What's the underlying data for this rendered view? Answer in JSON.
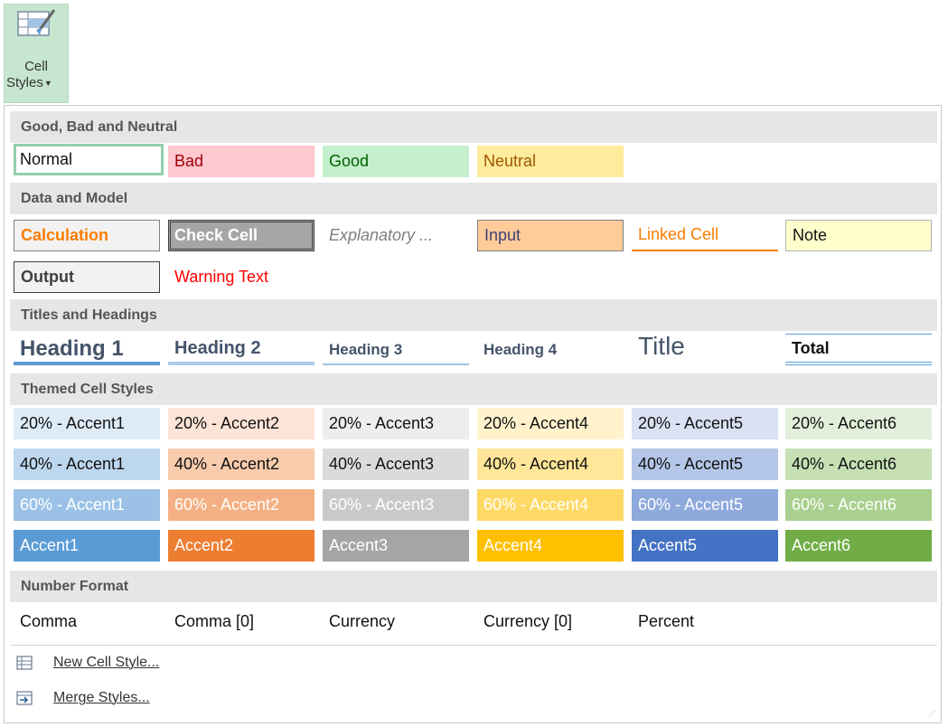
{
  "ribbon": {
    "button_line1": "Cell",
    "button_line2": "Styles",
    "icon": "cell-styles-icon"
  },
  "sections": {
    "good_bad_neutral": "Good, Bad and Neutral",
    "data_model": "Data and Model",
    "titles_headings": "Titles and Headings",
    "themed": "Themed Cell Styles",
    "number_format": "Number Format"
  },
  "good_bad_neutral": [
    "Normal",
    "Bad",
    "Good",
    "Neutral"
  ],
  "data_model": [
    "Calculation",
    "Check Cell",
    "Explanatory ...",
    "Input",
    "Linked Cell",
    "Note",
    "Output",
    "Warning Text"
  ],
  "titles": [
    "Heading 1",
    "Heading 2",
    "Heading 3",
    "Heading 4",
    "Title",
    "Total"
  ],
  "themed": {
    "row20": [
      "20% - Accent1",
      "20% - Accent2",
      "20% - Accent3",
      "20% - Accent4",
      "20% - Accent5",
      "20% - Accent6"
    ],
    "row40": [
      "40% - Accent1",
      "40% - Accent2",
      "40% - Accent3",
      "40% - Accent4",
      "40% - Accent5",
      "40% - Accent6"
    ],
    "row60": [
      "60% - Accent1",
      "60% - Accent2",
      "60% - Accent3",
      "60% - Accent4",
      "60% - Accent5",
      "60% - Accent6"
    ],
    "row100": [
      "Accent1",
      "Accent2",
      "Accent3",
      "Accent4",
      "Accent5",
      "Accent6"
    ],
    "colors20": [
      "#ddebf7",
      "#fce4d6",
      "#ededed",
      "#fff2cc",
      "#d9e1f2",
      "#e2efda"
    ],
    "colors40": [
      "#bdd7ee",
      "#f8cbad",
      "#dbdbdb",
      "#ffe699",
      "#b4c6e7",
      "#c6e0b4"
    ],
    "colors60": [
      "#9bc2e6",
      "#f4b084",
      "#c9c9c9",
      "#ffd966",
      "#8ea9db",
      "#a9d08e"
    ],
    "colors100": [
      "#5b9bd5",
      "#ed7d31",
      "#a5a5a5",
      "#ffc000",
      "#4472c4",
      "#70ad47"
    ]
  },
  "number_format": [
    "Comma",
    "Comma [0]",
    "Currency",
    "Currency [0]",
    "Percent"
  ],
  "menu": {
    "new_style": "New Cell Style...",
    "merge_styles": "Merge Styles..."
  }
}
